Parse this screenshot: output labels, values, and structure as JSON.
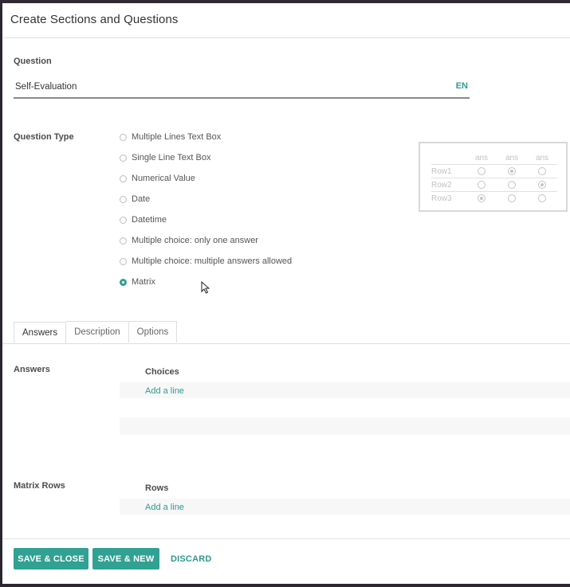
{
  "dialog": {
    "title": "Create Sections and Questions"
  },
  "question": {
    "label": "Question",
    "value": "Self-Evaluation",
    "lang": "EN"
  },
  "question_type": {
    "label": "Question Type",
    "options": [
      {
        "label": "Multiple Lines Text Box",
        "checked": false
      },
      {
        "label": "Single Line Text Box",
        "checked": false
      },
      {
        "label": "Numerical Value",
        "checked": false
      },
      {
        "label": "Date",
        "checked": false
      },
      {
        "label": "Datetime",
        "checked": false
      },
      {
        "label": "Multiple choice: only one answer",
        "checked": false
      },
      {
        "label": "Multiple choice: multiple answers allowed",
        "checked": false
      },
      {
        "label": "Matrix",
        "checked": true
      }
    ]
  },
  "matrix_preview": {
    "columns": [
      "ans",
      "ans",
      "ans"
    ],
    "rows": [
      {
        "label": "Row1",
        "selected": [
          false,
          true,
          false
        ]
      },
      {
        "label": "Row2",
        "selected": [
          false,
          false,
          true
        ]
      },
      {
        "label": "Row3",
        "selected": [
          true,
          false,
          false
        ]
      }
    ]
  },
  "tabs": [
    {
      "label": "Answers",
      "active": true
    },
    {
      "label": "Description",
      "active": false
    },
    {
      "label": "Options",
      "active": false
    }
  ],
  "answers": {
    "label": "Answers",
    "column_header": "Choices",
    "add_line": "Add a line"
  },
  "matrix_rows": {
    "label": "Matrix Rows",
    "column_header": "Rows",
    "add_line": "Add a line"
  },
  "footer": {
    "save_close": "SAVE & CLOSE",
    "save_new": "SAVE & NEW",
    "discard": "DISCARD"
  },
  "colors": {
    "accent": "#30a192",
    "link": "#2f9a8e"
  }
}
